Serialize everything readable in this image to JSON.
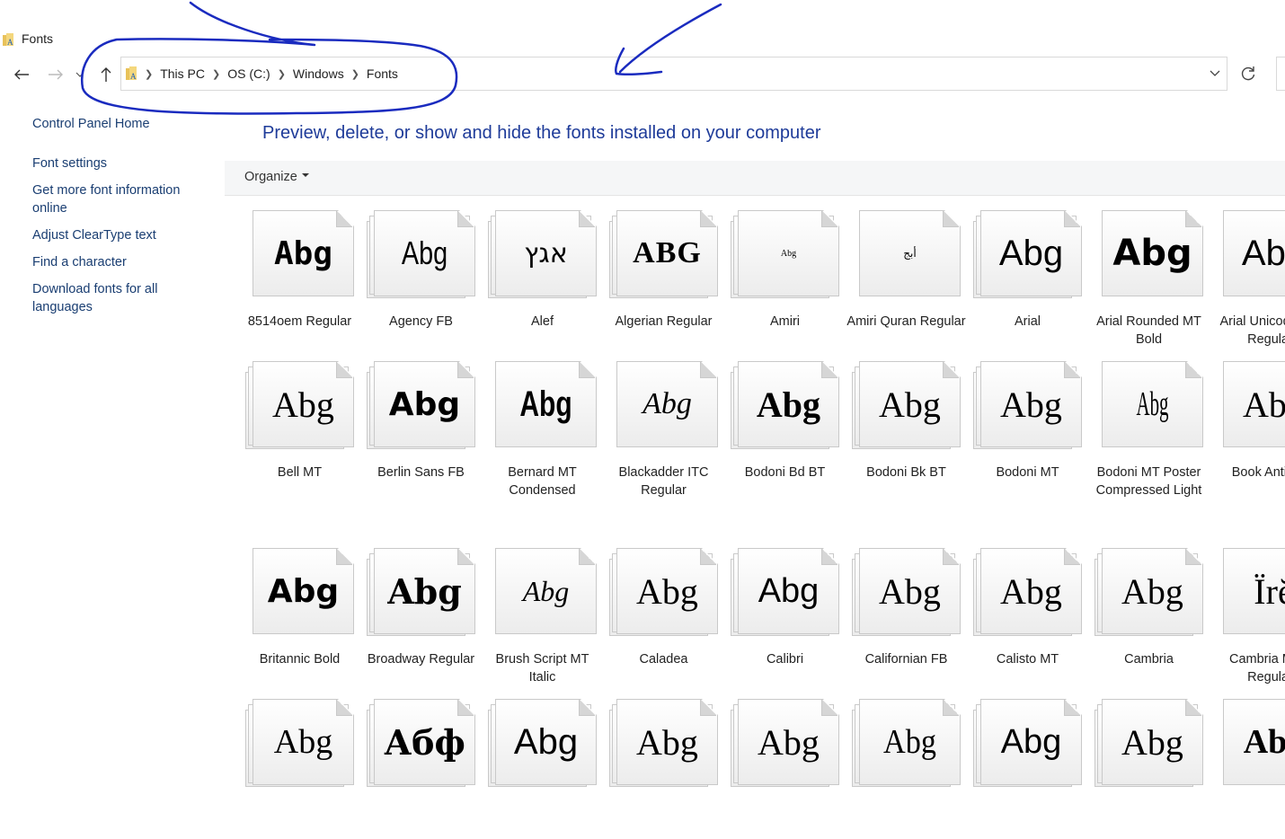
{
  "window": {
    "title": "Fonts"
  },
  "nav": {
    "back": "back-arrow-icon",
    "forward": "forward-arrow-icon",
    "up": "up-arrow-icon",
    "recent": "chevron-down-icon"
  },
  "address": {
    "crumbs": [
      "This PC",
      "OS (C:)",
      "Windows",
      "Fonts"
    ],
    "dropdown_icon": "chevron-down-icon",
    "refresh_icon": "refresh-icon"
  },
  "sidebar": {
    "home": "Control Panel Home",
    "links": [
      "Font settings",
      "Get more font information online",
      "Adjust ClearType text",
      "Find a character",
      "Download fonts for all languages"
    ]
  },
  "heading": "Preview, delete, or show and hide the fonts installed on your computer",
  "toolbar": {
    "organize": "Organize"
  },
  "fonts": [
    {
      "name": "8514oem Regular",
      "sample": "Abg"
    },
    {
      "name": "Agency FB",
      "sample": "Abg"
    },
    {
      "name": "Alef",
      "sample": "אגץ"
    },
    {
      "name": "Algerian Regular",
      "sample": "ABG"
    },
    {
      "name": "Amiri",
      "sample": "Abg"
    },
    {
      "name": "Amiri Quran Regular",
      "sample": "أبج"
    },
    {
      "name": "Arial",
      "sample": "Abg"
    },
    {
      "name": "Arial Rounded MT Bold",
      "sample": "Abg"
    },
    {
      "name": "Arial Unicode MS Regular",
      "sample": "Abg"
    },
    {
      "name": "Bell MT",
      "sample": "Abg"
    },
    {
      "name": "Berlin Sans FB",
      "sample": "Abg"
    },
    {
      "name": "Bernard MT Condensed",
      "sample": "Abg"
    },
    {
      "name": "Blackadder ITC Regular",
      "sample": "Abg"
    },
    {
      "name": "Bodoni Bd BT",
      "sample": "Abg"
    },
    {
      "name": "Bodoni Bk BT",
      "sample": "Abg"
    },
    {
      "name": "Bodoni MT",
      "sample": "Abg"
    },
    {
      "name": "Bodoni MT Poster Compressed Light",
      "sample": "Abg"
    },
    {
      "name": "Book Antiqua",
      "sample": "Abg"
    },
    {
      "name": "Britannic Bold",
      "sample": "Abg"
    },
    {
      "name": "Broadway Regular",
      "sample": "Abg"
    },
    {
      "name": "Brush Script MT Italic",
      "sample": "Abg"
    },
    {
      "name": "Caladea",
      "sample": "Abg"
    },
    {
      "name": "Calibri",
      "sample": "Abg"
    },
    {
      "name": "Californian FB",
      "sample": "Abg"
    },
    {
      "name": "Calisto MT",
      "sample": "Abg"
    },
    {
      "name": "Cambria",
      "sample": "Abg"
    },
    {
      "name": "Cambria Math Regular",
      "sample": "Ïrĕ"
    },
    {
      "name": "",
      "sample": "Abg"
    },
    {
      "name": "",
      "sample": "Абф"
    },
    {
      "name": "",
      "sample": "Abg"
    },
    {
      "name": "",
      "sample": "Abg"
    },
    {
      "name": "",
      "sample": "Abg"
    },
    {
      "name": "",
      "sample": "Abg"
    },
    {
      "name": "",
      "sample": "Abg"
    },
    {
      "name": "",
      "sample": "Abg"
    },
    {
      "name": "",
      "sample": "Abg"
    }
  ],
  "colors": {
    "heading": "#1e3b99",
    "link": "#1a3e72",
    "annotation": "#1a2bbf",
    "toolbar": "#f5f6f7"
  }
}
